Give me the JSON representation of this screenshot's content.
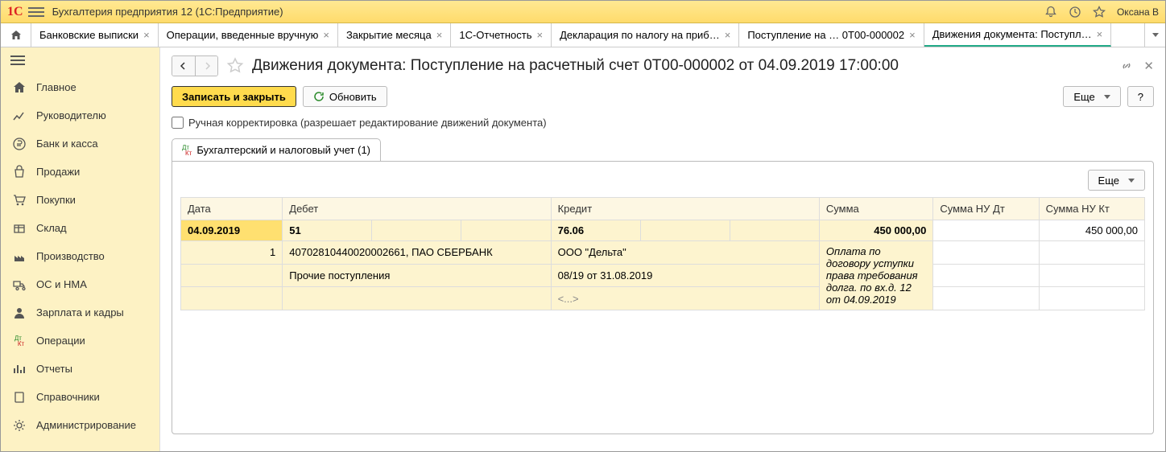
{
  "titlebar": {
    "app_title": "Бухгалтерия предприятия 12  (1С:Предприятие)",
    "user_name": "Оксана В"
  },
  "tabs": [
    {
      "label": "Банковские выписки"
    },
    {
      "label": "Операции, введенные вручную"
    },
    {
      "label": "Закрытие месяца"
    },
    {
      "label": "1С-Отчетность"
    },
    {
      "label": "Декларация по налогу на приб…"
    },
    {
      "label": "Поступление на …   0Т00-000002"
    },
    {
      "label": "Движения документа: Поступл…",
      "active": true
    }
  ],
  "sidebar": {
    "items": [
      {
        "label": "Главное",
        "icon": "home"
      },
      {
        "label": "Руководителю",
        "icon": "chart"
      },
      {
        "label": "Банк и касса",
        "icon": "ruble"
      },
      {
        "label": "Продажи",
        "icon": "bag"
      },
      {
        "label": "Покупки",
        "icon": "cart"
      },
      {
        "label": "Склад",
        "icon": "box"
      },
      {
        "label": "Производство",
        "icon": "factory"
      },
      {
        "label": "ОС и НМА",
        "icon": "truck"
      },
      {
        "label": "Зарплата и кадры",
        "icon": "person"
      },
      {
        "label": "Операции",
        "icon": "dtkt"
      },
      {
        "label": "Отчеты",
        "icon": "bars"
      },
      {
        "label": "Справочники",
        "icon": "book"
      },
      {
        "label": "Администрирование",
        "icon": "gear"
      }
    ]
  },
  "page": {
    "title": "Движения документа: Поступление на расчетный счет 0Т00-000002 от 04.09.2019 17:00:00",
    "save_btn": "Записать и закрыть",
    "refresh_btn": "Обновить",
    "checkbox_label": "Ручная корректировка (разрешает редактирование движений документа)",
    "tab_label": "Бухгалтерский и налоговый учет (1)",
    "more_btn": "Еще",
    "help_btn": "?",
    "table_more_btn": "Еще"
  },
  "grid": {
    "columns": [
      "Дата",
      "Дебет",
      "Кредит",
      "Сумма",
      "Сумма НУ Дт",
      "Сумма НУ Кт"
    ],
    "row": {
      "date": "04.09.2019",
      "n": "1",
      "debit_acct": "51",
      "debit_analytic1": "40702810440020002661, ПАО СБЕРБАНК",
      "debit_analytic2": "Прочие поступления",
      "credit_acct": "76.06",
      "credit_analytic1": "ООО \"Дельта\"",
      "credit_analytic2": "08/19 от 31.08.2019",
      "credit_analytic3": "<...>",
      "amount": "450 000,00",
      "amount_desc": "Оплата по договору уступки права требования долга. по вх.д. 12 от 04.09.2019",
      "amount_nu_kt": "450 000,00"
    }
  }
}
